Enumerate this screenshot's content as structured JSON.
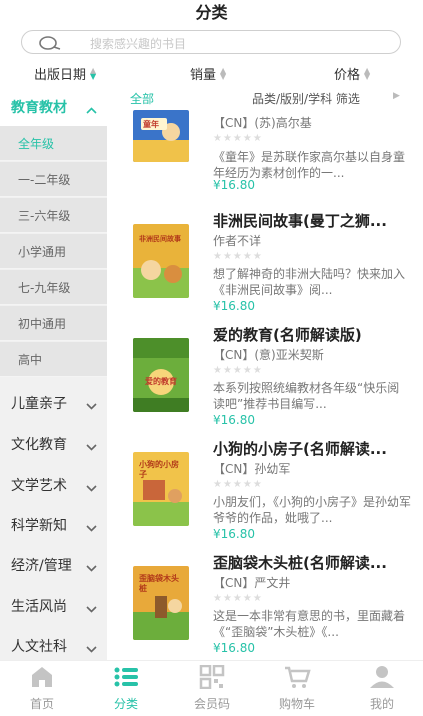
{
  "header": {
    "title": "分类"
  },
  "search": {
    "placeholder": "搜索感兴趣的书目"
  },
  "sort": [
    {
      "label": "出版日期",
      "active": true
    },
    {
      "label": "销量",
      "active": false
    },
    {
      "label": "价格",
      "active": false
    }
  ],
  "sidebar": {
    "open_category": "教育教材",
    "sub_items": [
      "全年级",
      "一-二年级",
      "三-六年级",
      "小学通用",
      "七-九年级",
      "初中通用",
      "高中"
    ],
    "active_sub": "全年级",
    "categories": [
      "儿童亲子",
      "文化教育",
      "文学艺术",
      "科学新知",
      "经济/管理",
      "生活风尚",
      "人文社科"
    ]
  },
  "filter": {
    "all_label": "全部",
    "text": "品类/版别/学科 筛选"
  },
  "books": [
    {
      "title": "",
      "author": "【CN】(苏)高尔基",
      "desc": "《童年》是苏联作家高尔基以自身童年经历为素材创作的一...",
      "price": "¥16.80",
      "cover_text": "童年",
      "cover_color": "#3a74c9"
    },
    {
      "title": "非洲民间故事(曼丁之狮...",
      "author": "作者不详",
      "desc": "想了解神奇的非洲大陆吗？快来加入《非洲民间故事》阅...",
      "price": "¥16.80",
      "cover_text": "非洲民间故事",
      "cover_color": "#e9b33a"
    },
    {
      "title": "爱的教育(名师解读版)",
      "author": "【CN】(意)亚米契斯",
      "desc": "本系列按照统编教材各年级“快乐阅读吧”推荐书目编写...",
      "price": "¥16.80",
      "cover_text": "爱的教育",
      "cover_color": "#6cae3c"
    },
    {
      "title": "小狗的小房子(名师解读...",
      "author": "【CN】孙幼军",
      "desc": "小朋友们，《小狗的小房子》是孙幼军爷爷的作品，妣哦了...",
      "price": "¥16.80",
      "cover_text": "小狗的小房子",
      "cover_color": "#f1c34a"
    },
    {
      "title": "歪脑袋木头桩(名师解读...",
      "author": "【CN】严文井",
      "desc": "这是一本非常有意思的书，里面藏着《“歪脑袋”木头桩》《...",
      "price": "¥16.80",
      "cover_text": "歪脑袋木头桩",
      "cover_color": "#e8a93a"
    }
  ],
  "tabs": [
    {
      "label": "首页",
      "icon": "home-icon"
    },
    {
      "label": "分类",
      "icon": "category-list-icon"
    },
    {
      "label": "会员码",
      "icon": "qrcode-icon"
    },
    {
      "label": "购物车",
      "icon": "cart-icon"
    },
    {
      "label": "我的",
      "icon": "user-icon"
    }
  ],
  "colors": {
    "accent": "#27c2a8",
    "sidebar_bg": "#f1f1f1"
  }
}
